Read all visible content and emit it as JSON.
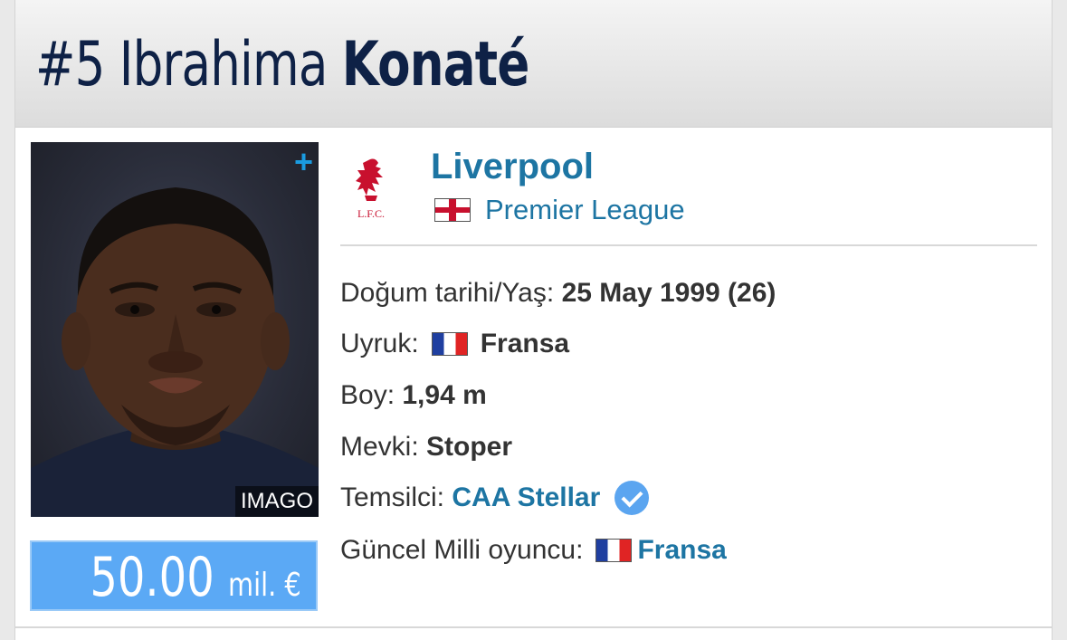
{
  "header": {
    "number": "#5",
    "first_name": "Ibrahima",
    "last_name": "Konaté"
  },
  "photo": {
    "credit": "IMAGO",
    "add_icon": "plus-icon"
  },
  "market_value": {
    "amount": "50.00",
    "unit": "mil. €"
  },
  "club": {
    "name": "Liverpool",
    "league": "Premier League",
    "league_flag": "england-flag-icon",
    "crest_text": "L.F.C."
  },
  "details": {
    "birth_label": "Doğum tarihi/Yaş:",
    "birth_value": "25 May 1999 (26)",
    "nationality_label": "Uyruk:",
    "nationality_value": "Fransa",
    "height_label": "Boy:",
    "height_value": "1,94 m",
    "position_label": "Mevki:",
    "position_value": "Stoper",
    "agent_label": "Temsilci:",
    "agent_value": "CAA Stellar",
    "national_label": "Güncel Milli oyuncu:",
    "national_value": "Fransa"
  },
  "colors": {
    "title": "#0e2146",
    "link": "#1d75a3",
    "value_box": "#5ba9f5",
    "verified": "#5ba5f0"
  }
}
